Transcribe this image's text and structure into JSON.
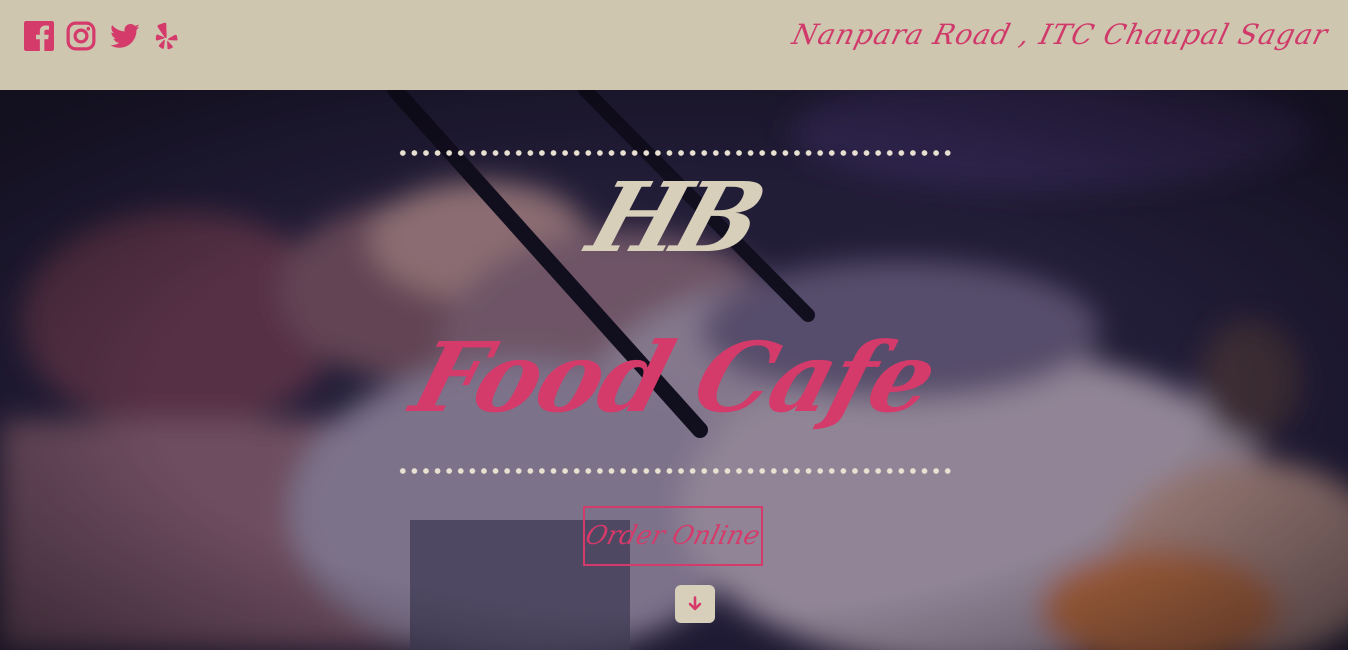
{
  "header": {
    "social_links": [
      {
        "name": "facebook-icon"
      },
      {
        "name": "instagram-icon"
      },
      {
        "name": "twitter-icon"
      },
      {
        "name": "yelp-icon"
      }
    ],
    "address": "Nanpara Road , ITC Chaupal Sagar"
  },
  "hero": {
    "monogram": "HB",
    "title": "Food Cafe",
    "order_button_label": "Order Online",
    "scroll_icon": "arrow-down-icon"
  },
  "colors": {
    "accent": "#d43a6a",
    "header_bg": "#cfc6b0",
    "cream": "#d8cfbb"
  }
}
